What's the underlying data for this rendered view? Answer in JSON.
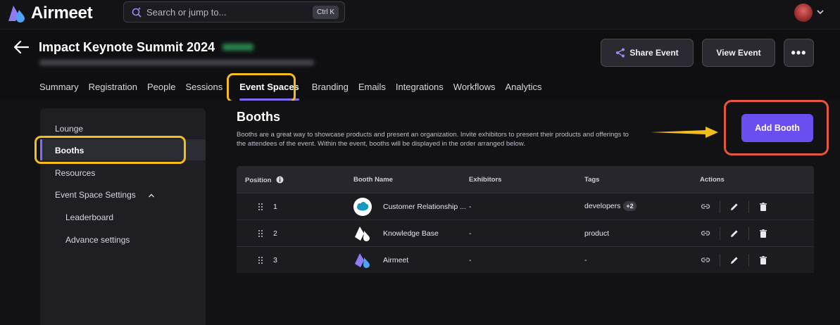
{
  "app": {
    "name": "Airmeet"
  },
  "search": {
    "placeholder": "Search or jump to...",
    "shortcut": "Ctrl K"
  },
  "event": {
    "title": "Impact Keynote Summit 2024"
  },
  "header_buttons": {
    "share": "Share Event",
    "view": "View Event",
    "more": "•••"
  },
  "tabs": [
    {
      "label": "Summary"
    },
    {
      "label": "Registration"
    },
    {
      "label": "People"
    },
    {
      "label": "Sessions"
    },
    {
      "label": "Event Spaces",
      "active": true
    },
    {
      "label": "Branding"
    },
    {
      "label": "Emails"
    },
    {
      "label": "Integrations"
    },
    {
      "label": "Workflows"
    },
    {
      "label": "Analytics"
    }
  ],
  "sidebar": {
    "items": [
      {
        "label": "Lounge"
      },
      {
        "label": "Booths",
        "active": true
      },
      {
        "label": "Resources"
      },
      {
        "label": "Event Space Settings"
      },
      {
        "label": "Leaderboard"
      },
      {
        "label": "Advance settings"
      }
    ]
  },
  "main": {
    "title": "Booths",
    "description": "Booths are a great way to showcase products and present an organization. Invite exhibitors to present their products and offerings to the attendees of the event. Within the event, booths will be displayed in the order arranged below.",
    "add_button": "Add Booth"
  },
  "table": {
    "columns": [
      "Position",
      "Booth Name",
      "Exhibitors",
      "Tags",
      "Actions"
    ],
    "rows": [
      {
        "position": "1",
        "name": "Customer Relationship ...",
        "exhibitors": "-",
        "tag": "developers",
        "extra_tags": "+2",
        "logo": "salesforce-logo"
      },
      {
        "position": "2",
        "name": "Knowledge Base",
        "exhibitors": "-",
        "tag": "product",
        "extra_tags": "",
        "logo": "knowledge-base-logo"
      },
      {
        "position": "3",
        "name": "Airmeet",
        "exhibitors": "-",
        "tag": "-",
        "extra_tags": "",
        "logo": "airmeet-logo"
      }
    ]
  },
  "colors": {
    "accent": "#6a4ef0",
    "tab_underline": "#7f6cf0",
    "highlight_yellow": "#f3bd1e",
    "highlight_red": "#e5573d",
    "arrow": "#f3bd1e"
  }
}
